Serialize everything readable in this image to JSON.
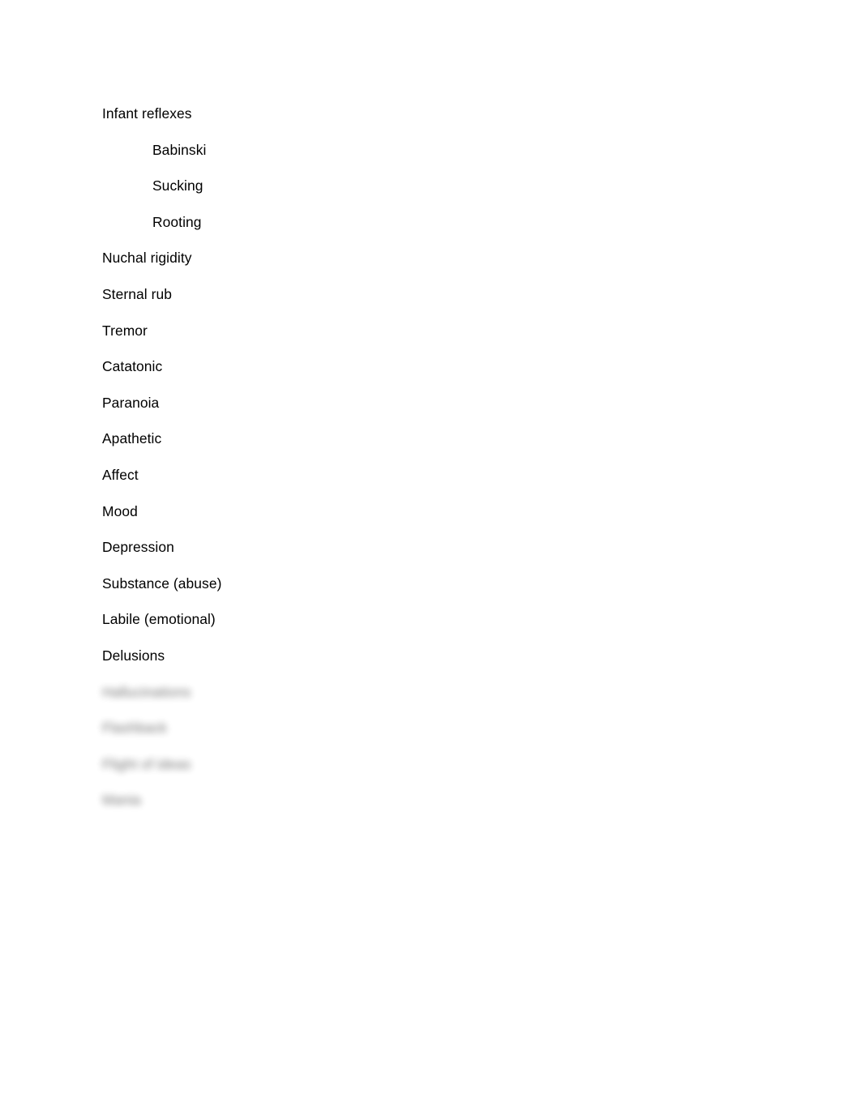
{
  "document": {
    "background_color": "#ffffff",
    "text_color": "#000000",
    "lines": [
      {
        "text": "Infant reflexes",
        "indent": 0,
        "redacted": false
      },
      {
        "text": "Babinski",
        "indent": 1,
        "redacted": false
      },
      {
        "text": "Sucking",
        "indent": 1,
        "redacted": false
      },
      {
        "text": "Rooting",
        "indent": 1,
        "redacted": false
      },
      {
        "text": "Nuchal rigidity",
        "indent": 0,
        "redacted": false
      },
      {
        "text": "Sternal rub",
        "indent": 0,
        "redacted": false
      },
      {
        "text": "Tremor",
        "indent": 0,
        "redacted": false
      },
      {
        "text": "Catatonic",
        "indent": 0,
        "redacted": false
      },
      {
        "text": "Paranoia",
        "indent": 0,
        "redacted": false
      },
      {
        "text": "Apathetic",
        "indent": 0,
        "redacted": false
      },
      {
        "text": "Affect",
        "indent": 0,
        "redacted": false
      },
      {
        "text": "Mood",
        "indent": 0,
        "redacted": false
      },
      {
        "text": "Depression",
        "indent": 0,
        "redacted": false
      },
      {
        "text": "Substance (abuse)",
        "indent": 0,
        "redacted": false
      },
      {
        "text": "Labile (emotional)",
        "indent": 0,
        "redacted": false
      },
      {
        "text": "Delusions",
        "indent": 0,
        "redacted": false
      },
      {
        "text": "Hallucinations",
        "indent": 0,
        "redacted": true
      },
      {
        "text": "Flashback",
        "indent": 0,
        "redacted": true
      },
      {
        "text": "Flight of ideas",
        "indent": 0,
        "redacted": true
      },
      {
        "text": "Mania",
        "indent": 0,
        "redacted": true
      }
    ]
  }
}
